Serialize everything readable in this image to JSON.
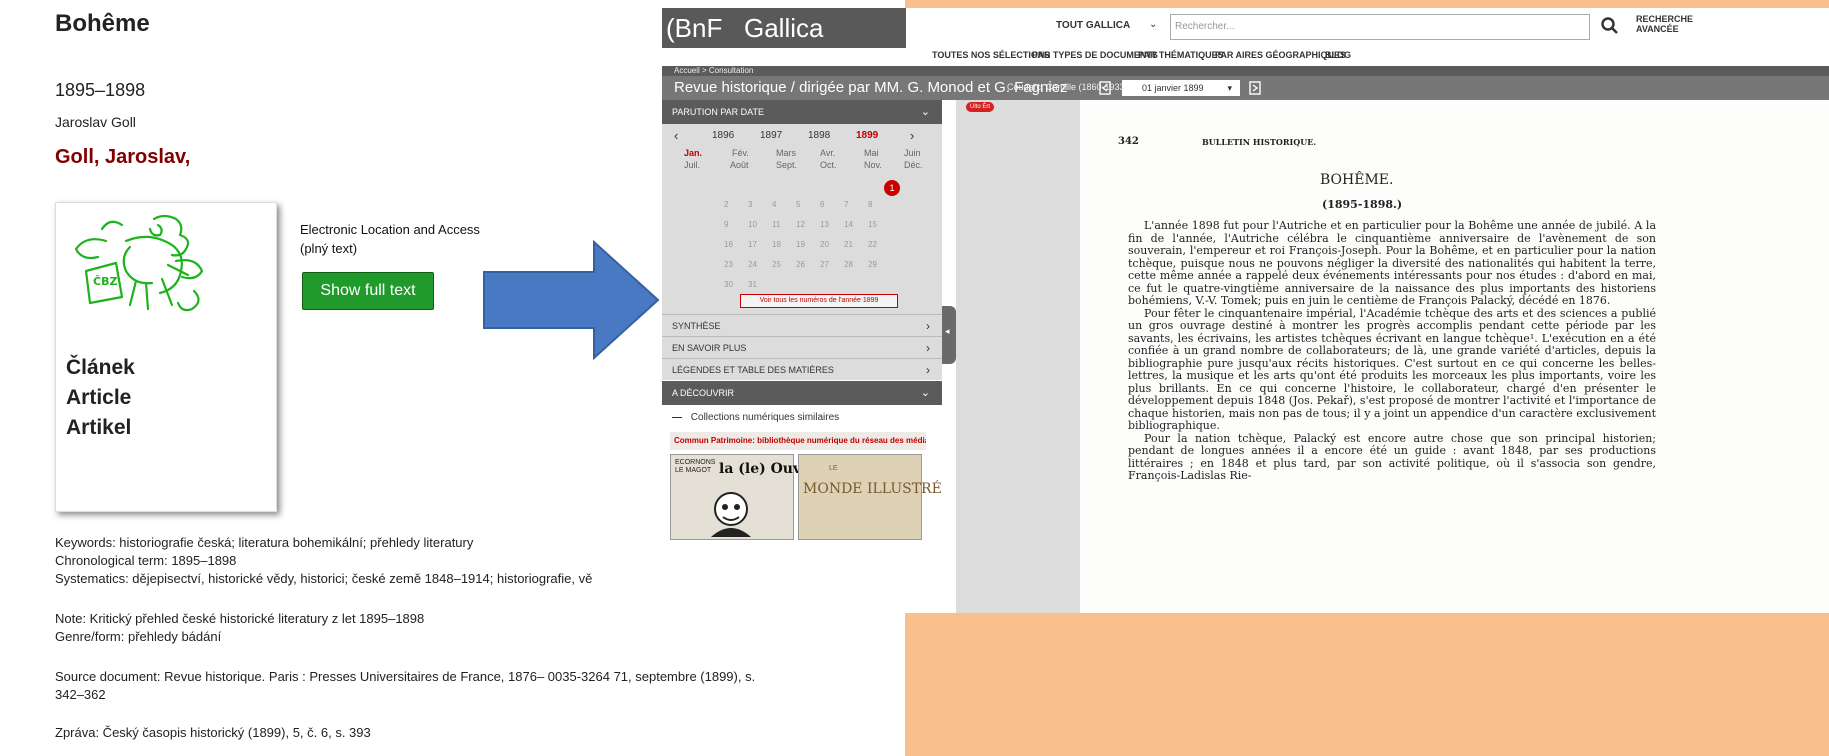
{
  "record": {
    "title": "Bohême",
    "years": "1895–1898",
    "author": "Jaroslav Goll",
    "heading": "Goll, Jaroslav,",
    "cover_lines": [
      "Článek",
      "Article",
      "Artikel"
    ],
    "cover_logo_text": "ČBZ",
    "ela_label": "Electronic Location and Access",
    "ela_sub": "(plný text)",
    "show_full_text": "Show full text",
    "keywords": "Keywords: historiografie česká; literatura bohemikální; přehledy literatury",
    "chronological": "Chronological term: 1895–1898",
    "systematics": "Systematics: dějepisectví, historické vědy, historici; české země 1848–1914; historiografie, vě",
    "note": "Note: Kritický přehled české historické literatury z let 1895–1898",
    "genre": "Genre/form: přehledy bádání",
    "source_line1": "Source document: Revue historique. Paris : Presses Universitaires de France, 1876– 0035-3264 71, septembre (1899), s.",
    "source_line2": "342–362",
    "zprava": "Zpráva: Český časopis historický (1899), 5, č. 6, s. 393"
  },
  "gallica": {
    "logo_bnf": "(BnF",
    "logo_gallica": "Gallica",
    "scope": "TOUT GALLICA",
    "search_placeholder": "Rechercher...",
    "advanced": "RECHERCHE AVANCÉE",
    "nav": [
      "TOUTES NOS SÉLECTIONS",
      "PAR TYPES DE DOCUMENTS",
      "PAR THÉMATIQUES",
      "PAR AIRES GÉOGRAPHIQUES",
      "BLOG"
    ],
    "breadcrumb": "Accueil > Consultation",
    "doc_title": "Revue historique / dirigée par MM. G. Monod et G. Fagniez",
    "doc_subtitle": "Couderc, Camille (1860-1933). Auteur du texte",
    "date_select": "01 janvier 1899",
    "sidebar": {
      "parution": "PARUTION PAR DATE",
      "years": [
        "1896",
        "1897",
        "1898",
        "1899"
      ],
      "months_row1": [
        "Jan.",
        "Fév.",
        "Mars",
        "Avr.",
        "Mai",
        "Juin"
      ],
      "months_row2": [
        "Juil.",
        "Août",
        "Sept.",
        "Oct.",
        "Nov.",
        "Déc."
      ],
      "selected_day": "1",
      "days": [
        "2",
        "3",
        "4",
        "5",
        "6",
        "7",
        "8",
        "9",
        "10",
        "11",
        "12",
        "13",
        "14",
        "15",
        "16",
        "17",
        "18",
        "19",
        "20",
        "21",
        "22",
        "23",
        "24",
        "25",
        "26",
        "27",
        "28",
        "29",
        "30",
        "31"
      ],
      "all_issues": "Voir tous les numéros de l'année 1899",
      "synthese": "SYNTHÈSE",
      "en_savoir_plus": "EN SAVOIR PLUS",
      "legendes": "LÉGENDES ET TABLE DES MATIÈRES",
      "a_decouvrir": "A DÉCOUVRIR",
      "collections": "Collections numériques similaires",
      "commun": "Commun Patrimoine: bibliothèque numérique du réseau des médiathèq...",
      "thumb1_a": "ECORNONS LE MAGOT",
      "thumb1_b": "la (le) Ouvrière",
      "thumb2_a": "LE",
      "thumb2_b": "MONDE ILLUSTRÉ"
    },
    "badge": "Ulto Ért",
    "page": {
      "number": "342",
      "running_head": "BULLETIN HISTORIQUE.",
      "title": "BOHÊME.",
      "years": "(1895-1898.)",
      "p1": "L'année 1898 fut pour l'Autriche et en particulier pour la Bohême une année de jubilé. A la fin de l'année, l'Autriche célébra le cinquantième anniversaire de l'avènement de son souverain, l'empereur et roi François-Joseph. Pour la Bohême, et en particulier pour la nation tchèque, puisque nous ne pouvons négliger la diversité des nationalités qui habitent la terre, cette même année a rappelé deux événements intéressants pour nos études : d'abord en mai, ce fut le quatre-vingtième anniversaire de la naissance des plus importants des historiens bohémiens, V.-V. Tomek; puis en juin le centième de François Palacký, décédé en 1876.",
      "p2": "Pour fêter le cinquantenaire impérial, l'Académie tchèque des arts et des sciences a publié un gros ouvrage destiné à montrer les progrès accomplis pendant cette période par les savants, les écrivains, les artistes tchèques écrivant en langue tchèque¹. L'exécution en a été confiée à un grand nombre de collaborateurs; de là, une grande variété d'articles, depuis la bibliographie pure jusqu'aux récits historiques. C'est surtout en ce qui concerne les belles-lettres, la musique et les arts qu'ont été produits les morceaux les plus importants, voire les plus brillants. En ce qui concerne l'histoire, le collaborateur, chargé d'en présenter le développement depuis 1848 (Jos. Pekař), s'est proposé de montrer l'activité et l'importance de chaque historien, mais non pas de tous; il y a joint un appendice d'un caractère exclusivement bibliographique.",
      "p3": "Pour la nation tchèque, Palacký est encore autre chose que son principal historien; pendant de longues années il a encore été un guide : avant 1848, par ses productions littéraires ; en 1848 et plus tard, par son activité politique, où il s'associa son gendre, François-Ladislas Rie-"
    }
  }
}
